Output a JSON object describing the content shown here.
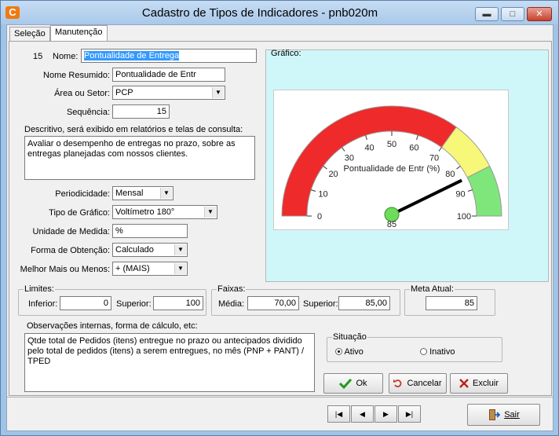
{
  "window": {
    "title": "Cadastro de Tipos de Indicadores - pnb020m",
    "app_icon_glyph": "C",
    "minimize": "▬",
    "maximize": "□",
    "close": "✕"
  },
  "tabs": [
    {
      "label": "Seleção"
    },
    {
      "label": "Manutenção"
    }
  ],
  "form": {
    "record_number": "15",
    "nome_label": "Nome:",
    "nome_value": "Pontualidade de Entrega",
    "nome_resumido_label": "Nome Resumido:",
    "nome_resumido_value": "Pontualidade de Entr",
    "area_label": "Área ou Setor:",
    "area_value": "PCP",
    "sequencia_label": "Sequência:",
    "sequencia_value": "15",
    "descritivo_label": "Descritivo, será exibido em relatórios e telas de consulta:",
    "descritivo_value": "Avaliar o desempenho de entregas no prazo, sobre as entregas planejadas com nossos clientes.",
    "periodicidade_label": "Periodicidade:",
    "periodicidade_value": "Mensal",
    "tipo_grafico_label": "Tipo de Gráfico:",
    "tipo_grafico_value": "Voltímetro 180°",
    "unidade_label": "Unidade de Medida:",
    "unidade_value": "%",
    "forma_label": "Forma de Obtenção:",
    "forma_value": "Calculado",
    "melhor_label": "Melhor Mais ou Menos:",
    "melhor_value": "+ (MAIS)"
  },
  "limites": {
    "title": "Limites:",
    "inferior_label": "Inferior:",
    "inferior_value": "0",
    "superior_label": "Superior:",
    "superior_value": "100"
  },
  "faixas": {
    "title": "Faixas:",
    "media_label": "Média:",
    "media_value": "70,00",
    "superior_label": "Superior:",
    "superior_value": "85,00"
  },
  "meta": {
    "title": "Meta Atual:",
    "value": "85"
  },
  "observacoes": {
    "label": "Observações internas, forma de cálculo, etc:",
    "value": "Qtde total de Pedidos (itens) entregue no prazo ou antecipados dividido pelo total de pedidos (itens) a serem entregues, no mês (PNP + PANT) / TPED"
  },
  "situacao": {
    "title": "Situação",
    "ativo_label": "Ativo",
    "inativo_label": "Inativo",
    "selected": "Ativo"
  },
  "buttons": {
    "ok": "Ok",
    "cancelar": "Cancelar",
    "excluir": "Excluir",
    "sair": "Sair",
    "nav_first": "|◀",
    "nav_prev": "◀",
    "nav_next": "▶",
    "nav_last": "▶|"
  },
  "chart_panel": {
    "title": "Gráfico:"
  },
  "chart_data": {
    "type": "gauge",
    "title": "Pontualidade de Entr (%)",
    "min": 0,
    "max": 100,
    "ticks": [
      0,
      10,
      20,
      30,
      40,
      50,
      60,
      70,
      80,
      90,
      100
    ],
    "bands": [
      {
        "from": 0,
        "to": 70,
        "color": "#ef2a2a"
      },
      {
        "from": 70,
        "to": 85,
        "color": "#f7f77a"
      },
      {
        "from": 85,
        "to": 100,
        "color": "#7ee67a"
      }
    ],
    "value": 85,
    "value_label": "85"
  }
}
